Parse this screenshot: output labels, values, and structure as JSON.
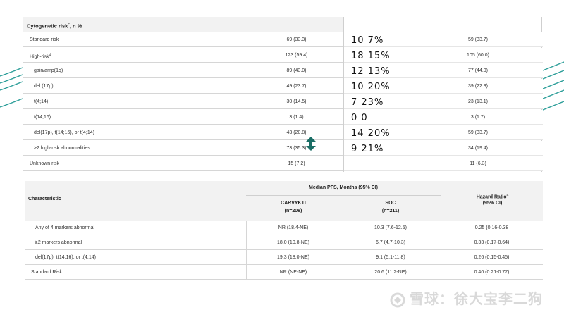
{
  "top_table": {
    "header": "Cytogenetic risk",
    "header_sup": "c",
    "header_suffix": ", n %",
    "rows": [
      {
        "label": "Standard risk",
        "sup": "",
        "carvykti": "69 (33.3)",
        "note": "",
        "soc": "59 (33.7)"
      },
      {
        "label": "High-risk",
        "sup": "d",
        "carvykti": "123 (59.4)",
        "note": "18 15%",
        "soc": "105 (60.0)"
      },
      {
        "label": "gain/amp(1q)",
        "sup": "",
        "carvykti": "89 (43.0)",
        "note": "12 13%",
        "soc": "77 (44.0)"
      },
      {
        "label": "del (17p)",
        "sup": "",
        "carvykti": "49 (23.7)",
        "note": "10 20%",
        "soc": "39 (22.3)"
      },
      {
        "label": "t(4;14)",
        "sup": "",
        "carvykti": "30 (14.5)",
        "note": "7 23%",
        "soc": "23 (13.1)"
      },
      {
        "label": "t(14;16)",
        "sup": "",
        "carvykti": "3 (1.4)",
        "note": "0 0",
        "soc": "3 (1.7)"
      },
      {
        "label": "del(17p), t(14;16), or t(4;14)",
        "sup": "",
        "carvykti": "43 (20.8)",
        "note": "14 20%",
        "soc": "59 (33.7)"
      },
      {
        "label": "≥2 high-risk abnormalities",
        "sup": "",
        "carvykti": "73 (35.3)",
        "note": "9 21%",
        "soc": "34 (19.4)"
      },
      {
        "label": "Unknown risk",
        "sup": "",
        "carvykti": "15 (7.2)",
        "note": "",
        "soc": "11 (6.3)"
      }
    ],
    "first_note": "10 7%"
  },
  "bottom_table": {
    "col_characteristic": "Characteristic",
    "col_group": "Median PFS, Months (95% CI)",
    "col_carvykti": "CARVYKTI",
    "col_carvykti_n": "(n=208)",
    "col_soc": "SOC",
    "col_soc_n": "(n=211)",
    "col_hr": "Hazard Ratio",
    "col_hr_sup": "a",
    "col_hr_ci": "(95% CI)",
    "rows": [
      {
        "label": "Any of 4 markers abnormal",
        "carvykti": "NR (18.4-NE)",
        "soc": "10.3 (7.6-12.5)",
        "hr": "0.25 (0.16-0.38"
      },
      {
        "label": "≥2 markers abnormal",
        "carvykti": "18.0 (10.8-NE)",
        "soc": "6.7 (4.7-10.3)",
        "hr": "0.33 (0.17-0.64)"
      },
      {
        "label": "del(17p), t(14;16), or t(4;14)",
        "carvykti": "19.3 (18.0-NE)",
        "soc": "9.1 (5.1-11.8)",
        "hr": "0.26 (0.15-0.45)"
      },
      {
        "label": "Standard Risk",
        "carvykti": "NR (NE-NE)",
        "soc": "20.6 (11.2-NE)",
        "hr": "0.40 (0.21-0.77)"
      }
    ]
  },
  "watermark": "雪球：徐大宝李二狗",
  "colors": {
    "teal": "#1f8a87",
    "arrow": "#1a6e66"
  }
}
